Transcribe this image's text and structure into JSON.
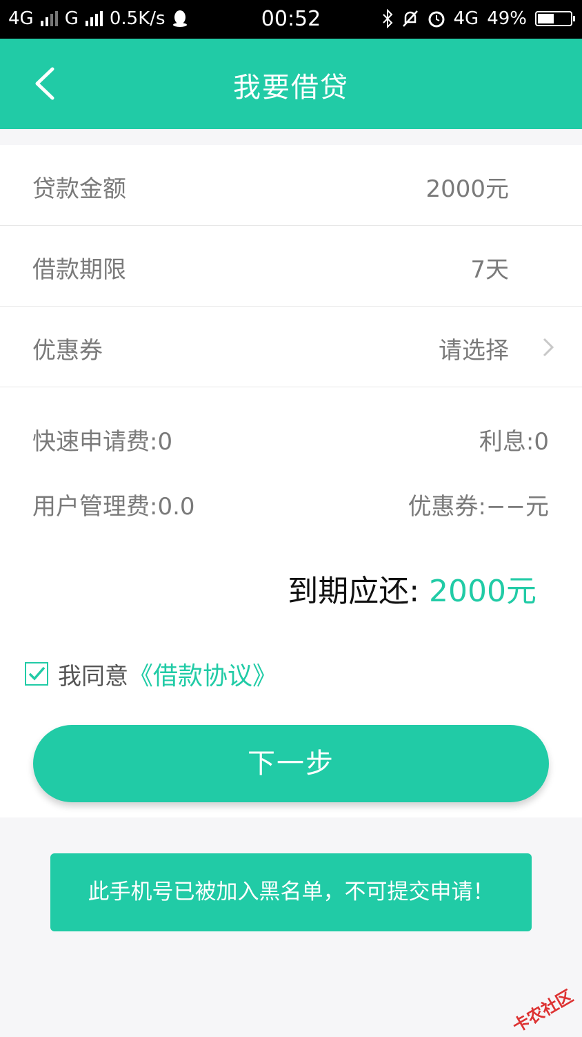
{
  "status_bar": {
    "net1": "4G",
    "net2": "G",
    "speed": "0.5K/s",
    "time": "00:52",
    "net3": "4G",
    "battery_pct": "49%",
    "battery_level": 0.49
  },
  "header": {
    "title": "我要借贷"
  },
  "form": {
    "rows": [
      {
        "label": "贷款金额",
        "value": "2000元"
      },
      {
        "label": "借款期限",
        "value": "7天"
      },
      {
        "label": "优惠券",
        "value": "请选择"
      }
    ]
  },
  "fees": {
    "fast_fee": "快速申请费:0",
    "interest": "利息:0",
    "mgmt_fee": "用户管理费:0.0",
    "coupon": "优惠券:−−元"
  },
  "due": {
    "label": "到期应还: ",
    "amount": "2000元"
  },
  "agreement": {
    "text": "我同意",
    "link": "《借款协议》",
    "checked": true
  },
  "buttons": {
    "next": "下一步"
  },
  "toast": {
    "message": "此手机号已被加入黑名单，不可提交申请！"
  },
  "watermark": {
    "text": "卡农社区"
  },
  "colors": {
    "accent": "#21cba6"
  }
}
